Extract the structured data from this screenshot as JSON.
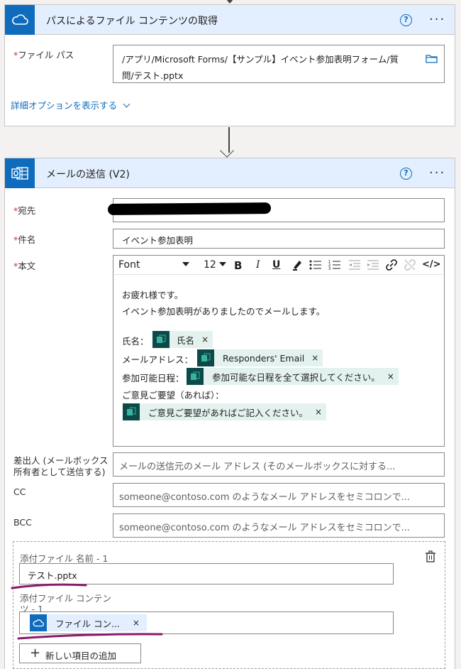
{
  "card1": {
    "title": "パスによるファイル コンテンツの取得",
    "field_label": "ファイル パス",
    "path_line1": "/アプリ/Microsoft Forms/【サンプル】イベント参加表明フォーム/質",
    "path_line2": "問/テスト.pptx",
    "advanced_link": "詳細オプションを表示する"
  },
  "card2": {
    "title": "メールの送信 (V2)",
    "to_label": "宛先",
    "subject_label": "件名",
    "subject_value": "イベント参加表明",
    "body_label": "本文",
    "toolbar": {
      "font": "Font",
      "size": "12",
      "bold": "B",
      "italic": "I",
      "underline": "U",
      "code": "</>"
    },
    "body_line1": "お疲れ様です。",
    "body_line2": "イベント参加表明がありましたのでメールします。",
    "name_label": "氏名：",
    "name_chip": "氏名",
    "email_label": "メールアドレス：",
    "email_chip": "Responders' Email",
    "date_label": "参加可能日程：",
    "date_chip": "参加可能な日程を全て選択してください。",
    "opinion_label": "ご意見ご要望（あれば）：",
    "opinion_chip": "ご意見ご要望があればご記入ください。",
    "from_label_1": "差出人 (メールボックス",
    "from_label_2": "所有者として送信する)",
    "from_placeholder": "メールの送信元のメール アドレス (そのメールボックスに対する...",
    "cc_label": "CC",
    "cc_placeholder": "someone@contoso.com のようなメール アドレスをセミコロンで...",
    "bcc_label": "BCC",
    "bcc_placeholder": "someone@contoso.com のようなメール アドレスをセミコロンで...",
    "attach_name_label": "添付ファイル 名前 - 1",
    "attach_name_value": "テスト.pptx",
    "attach_content_label_1": "添付ファイル コンテン",
    "attach_content_label_2": "ツ - 1",
    "attach_content_chip": "ファイル コン...",
    "add_item": "新しい項目の追加",
    "chip_close": "×",
    "required_mark": "*"
  },
  "colors": {
    "accent": "#0f6cbd",
    "header_bg": "#e3efff",
    "chip_bg": "#e4f2ef",
    "chip_icon": "#0b4a48",
    "annotation": "#8b1a6b"
  }
}
